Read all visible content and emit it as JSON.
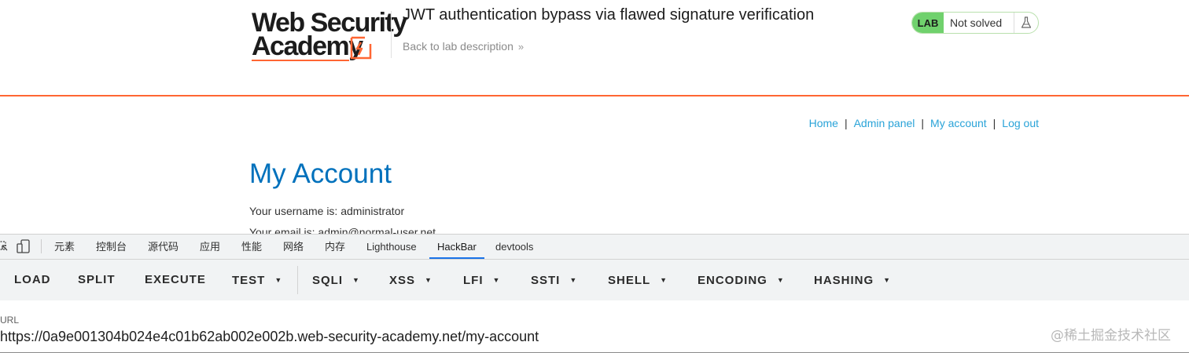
{
  "header": {
    "logo_line1": "Web Security",
    "logo_line2": "Academy",
    "lab_title": "JWT authentication bypass via flawed signature verification",
    "back_link": "Back to lab description",
    "lab_badge": "LAB",
    "lab_status": "Not solved"
  },
  "nav": {
    "home": "Home",
    "admin_panel": "Admin panel",
    "my_account": "My account",
    "log_out": "Log out",
    "separator": "|"
  },
  "main": {
    "heading": "My Account",
    "username_line": "Your username is: administrator",
    "email_line": "Your email is: admin@normal-user.net"
  },
  "devtools": {
    "tabs": [
      "元素",
      "控制台",
      "源代码",
      "应用",
      "性能",
      "网络",
      "内存",
      "Lighthouse",
      "HackBar",
      "devtools"
    ],
    "active_tab": "HackBar"
  },
  "hackbar": {
    "buttons": [
      "LOAD",
      "SPLIT",
      "EXECUTE",
      "TEST",
      "SQLI",
      "XSS",
      "LFI",
      "SSTI",
      "SHELL",
      "ENCODING",
      "HASHING"
    ],
    "url_label": "URL",
    "url_value": "https://0a9e001304b024e4c01b62ab002e002b.web-security-academy.net/my-account"
  },
  "watermark": "@稀土掘金技术社区",
  "colors": {
    "accent_orange": "#ff6633",
    "heading_blue": "#0071bc",
    "link_blue": "#29a3d8",
    "lab_green": "#70d16d",
    "active_tab_blue": "#1a73e8"
  },
  "icons": [
    "inspect-icon",
    "device-toolbar-icon",
    "flask-icon",
    "chevrons-right-icon",
    "caret-down-icon",
    "logo-bolt-icon"
  ]
}
